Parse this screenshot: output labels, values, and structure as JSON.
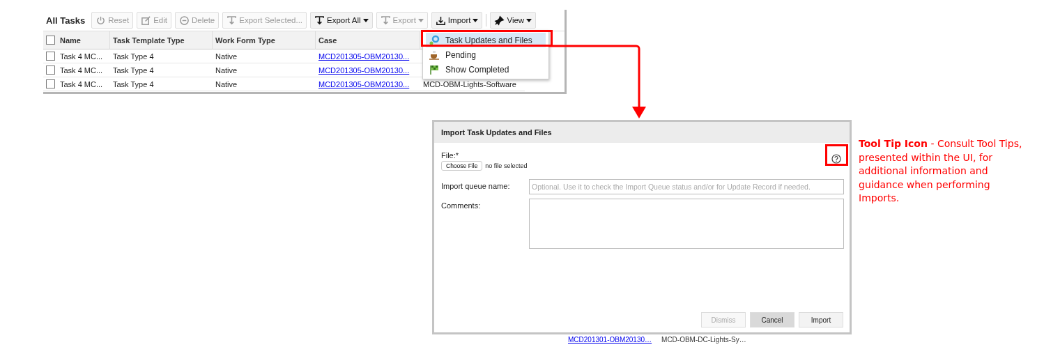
{
  "toolbar": {
    "title": "All Tasks",
    "buttons": [
      {
        "label": "Reset",
        "disabled": true,
        "dropdown": false
      },
      {
        "label": "Edit",
        "disabled": true,
        "dropdown": false
      },
      {
        "label": "Delete",
        "disabled": true,
        "dropdown": false
      },
      {
        "label": "Export Selected...",
        "disabled": true,
        "dropdown": false
      },
      {
        "label": "Export All",
        "disabled": false,
        "dropdown": true
      },
      {
        "label": "Export",
        "disabled": true,
        "dropdown": true
      },
      {
        "label": "Import",
        "disabled": false,
        "dropdown": true
      },
      {
        "label": "View",
        "disabled": false,
        "dropdown": true
      }
    ]
  },
  "table": {
    "header_checked": false,
    "columns": [
      "Name",
      "Task Template Type",
      "Work Form Type",
      "Case"
    ],
    "rows": [
      {
        "checked": false,
        "cells": [
          "Task 4 MC...",
          "Task Type 4",
          "Native",
          "MCD201305-OBM20130..."
        ]
      },
      {
        "checked": false,
        "cells": [
          "Task 4 MC...",
          "Task Type 4",
          "Native",
          "MCD201305-OBM20130..."
        ]
      },
      {
        "checked": false,
        "cells": [
          "Task 4 MC...",
          "Task Type 4",
          "Native",
          "MCD201305-OBM20130...",
          "MCD-OBM-Lights-Software"
        ]
      }
    ]
  },
  "import_menu": {
    "items": [
      {
        "label": "Task Updates and Files",
        "selected": true
      },
      {
        "label": "Pending",
        "selected": false
      },
      {
        "label": "Show Completed",
        "selected": false
      }
    ]
  },
  "dialog": {
    "title": "Import Task Updates and Files",
    "file_label": "File:*",
    "choose_button": "Choose File",
    "file_status": "no file selected",
    "queue_label": "Import queue name:",
    "queue_placeholder": "Optional. Use it to check the Import Queue status and/or for Update Record if needed.",
    "comments_label": "Comments:",
    "buttons": [
      {
        "label": "Dismiss",
        "disabled": true,
        "selected": false
      },
      {
        "label": "Cancel",
        "disabled": false,
        "selected": true
      },
      {
        "label": "Import",
        "disabled": false,
        "selected": false
      }
    ]
  },
  "background_row": [
    "MCD201301-OBM20130…",
    "MCD-OBM-DC-Lights-Sy…"
  ],
  "annotation": {
    "text": "**Tool Tip Icon** - Consult Tool Tips, presented within the UI, for additional information and guidance when performing Imports."
  }
}
